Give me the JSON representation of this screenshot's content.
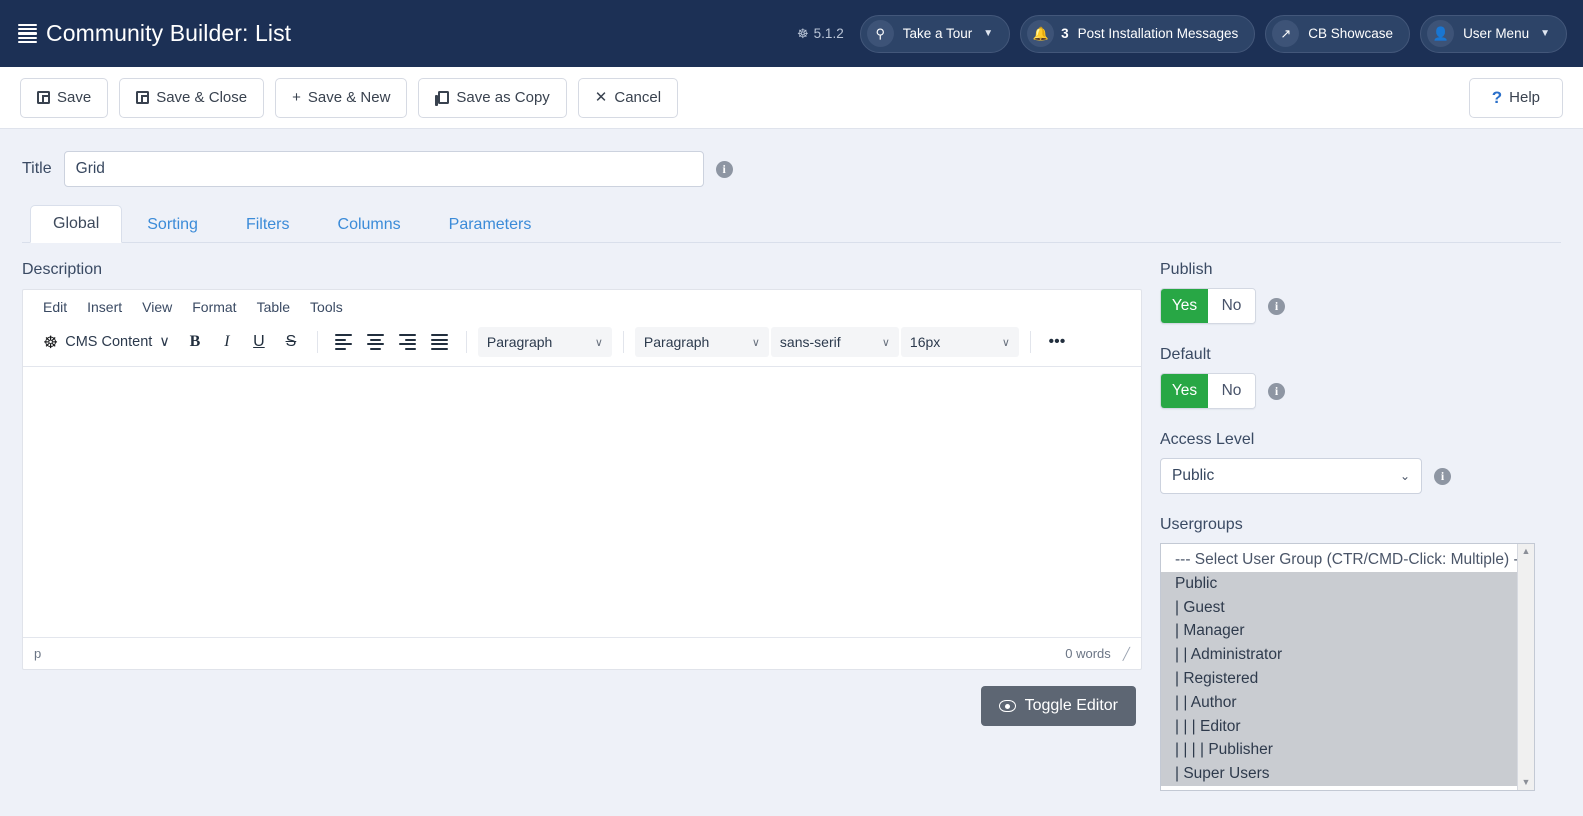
{
  "header": {
    "brand_icon": "list-icon",
    "title": "Community Builder: List",
    "version": "5.1.2",
    "version_icon": "joomla-icon",
    "tour": {
      "icon": "signpost-icon",
      "label": "Take a Tour",
      "caret": "▼"
    },
    "messages": {
      "icon": "bell-icon",
      "count": "3",
      "label": "Post Installation Messages"
    },
    "showcase": {
      "icon": "external-link-icon",
      "label": "CB Showcase"
    },
    "user_menu": {
      "icon": "user-circle-icon",
      "label": "User Menu",
      "caret": "▼"
    }
  },
  "toolbar": {
    "save": "Save",
    "save_close": "Save & Close",
    "save_new": "Save & New",
    "save_copy": "Save as Copy",
    "cancel": "Cancel",
    "cancel_glyph": "✕",
    "plus_glyph": "+",
    "help": "Help",
    "help_glyph": "?"
  },
  "form": {
    "title_label": "Title",
    "title_value": "Grid",
    "title_placeholder": ""
  },
  "tabs": [
    {
      "label": "Global",
      "active": true
    },
    {
      "label": "Sorting",
      "active": false
    },
    {
      "label": "Filters",
      "active": false
    },
    {
      "label": "Columns",
      "active": false
    },
    {
      "label": "Parameters",
      "active": false
    }
  ],
  "editor": {
    "field_label": "Description",
    "menubar": [
      "Edit",
      "Insert",
      "View",
      "Format",
      "Table",
      "Tools"
    ],
    "cms_content": "CMS Content",
    "cms_caret": "∨",
    "buttons": {
      "bold": "B",
      "italic": "I",
      "underline": "U",
      "strikethrough": "S",
      "more": "•••"
    },
    "selects": {
      "blocks": "Paragraph",
      "styles": "Paragraph",
      "fontfamily": "sans-serif",
      "fontsize": "16px",
      "caret": "∨"
    },
    "status_path": "p",
    "word_count": "0 words",
    "resize_glyph": "╱",
    "toggle_button": "Toggle Editor",
    "toggle_icon": "eye-icon"
  },
  "sidebar": {
    "publish": {
      "label": "Publish",
      "yes": "Yes",
      "no": "No",
      "selected": "Yes",
      "info_icon": "info-icon"
    },
    "default": {
      "label": "Default",
      "yes": "Yes",
      "no": "No",
      "selected": "Yes",
      "info_icon": "info-icon"
    },
    "access_level": {
      "label": "Access Level",
      "value": "Public",
      "caret": "⌄",
      "info_icon": "info-icon"
    },
    "usergroups": {
      "label": "Usergroups",
      "placeholder_option": "--- Select User Group (CTR/CMD-Click: Multiple) ---",
      "options": [
        {
          "label": "Public",
          "selected": true
        },
        {
          "label": "| Guest",
          "selected": true
        },
        {
          "label": "| Manager",
          "selected": true
        },
        {
          "label": "| | Administrator",
          "selected": true
        },
        {
          "label": "| Registered",
          "selected": true
        },
        {
          "label": "| | Author",
          "selected": true
        },
        {
          "label": "| | | Editor",
          "selected": true
        },
        {
          "label": "| | | | Publisher",
          "selected": true
        },
        {
          "label": "| Super Users",
          "selected": true
        }
      ],
      "scroll_up": "▲",
      "scroll_down": "▼"
    }
  },
  "colors": {
    "header_bg": "#1c3055",
    "page_bg": "#eef1f8",
    "accent_link": "#3b8bd8",
    "success_green": "#28a745",
    "toggle_gray": "#5d6673"
  }
}
